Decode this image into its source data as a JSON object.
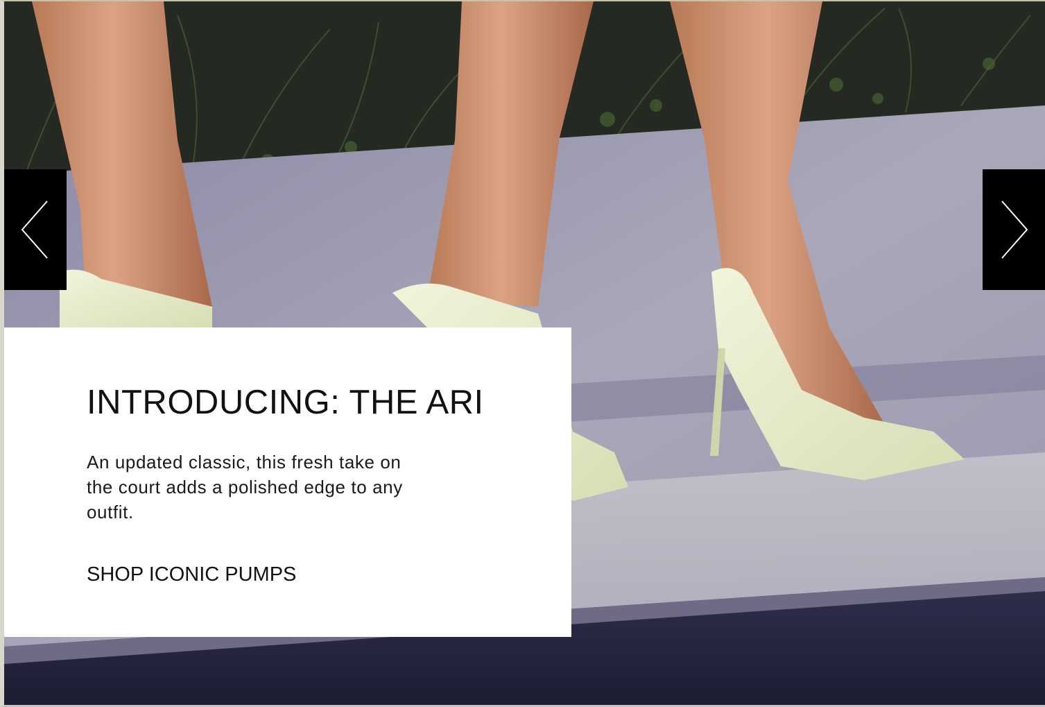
{
  "carousel": {
    "prev_icon": "chevron-left-icon",
    "next_icon": "chevron-right-icon"
  },
  "promo": {
    "title": "INTRODUCING: THE ARI",
    "description": "An updated classic, this fresh take on the court adds a polished edge to any outfit.",
    "cta_label": "SHOP ICONIC PUMPS"
  },
  "colors": {
    "arrow_background": "#000000",
    "card_background": "#ffffff",
    "shoe_color": "#e4eac8"
  }
}
